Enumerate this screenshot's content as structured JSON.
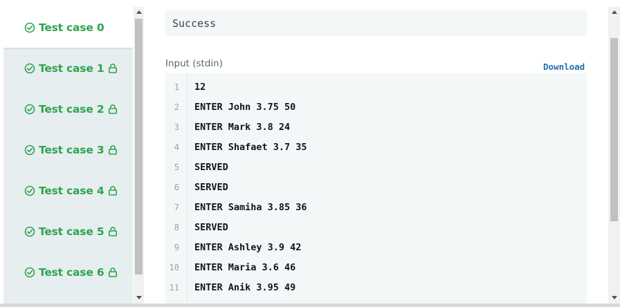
{
  "sidebar": {
    "items": [
      {
        "label": "Test case 0",
        "locked": false,
        "active": true
      },
      {
        "label": "Test case 1",
        "locked": true,
        "active": false
      },
      {
        "label": "Test case 2",
        "locked": true,
        "active": false
      },
      {
        "label": "Test case 3",
        "locked": true,
        "active": false
      },
      {
        "label": "Test case 4",
        "locked": true,
        "active": false
      },
      {
        "label": "Test case 5",
        "locked": true,
        "active": false
      },
      {
        "label": "Test case 6",
        "locked": true,
        "active": false
      }
    ]
  },
  "main": {
    "result": "Success",
    "input_label": "Input (stdin)",
    "download_label": "Download",
    "lines": [
      {
        "num": "1",
        "text": "12"
      },
      {
        "num": "2",
        "text": "ENTER John 3.75 50"
      },
      {
        "num": "3",
        "text": "ENTER Mark 3.8 24"
      },
      {
        "num": "4",
        "text": "ENTER Shafaet 3.7 35"
      },
      {
        "num": "5",
        "text": "SERVED"
      },
      {
        "num": "6",
        "text": "SERVED"
      },
      {
        "num": "7",
        "text": "ENTER Samiha 3.85 36"
      },
      {
        "num": "8",
        "text": "SERVED"
      },
      {
        "num": "9",
        "text": "ENTER Ashley 3.9 42"
      },
      {
        "num": "10",
        "text": "ENTER Maria 3.6 46"
      },
      {
        "num": "11",
        "text": "ENTER Anik 3.95 49"
      }
    ]
  },
  "colors": {
    "success_green": "#2ea44f",
    "link_blue": "#1f6fae",
    "sidebar_bg": "#e7eeef"
  },
  "icons": {
    "status": "check-circle-icon",
    "locked": "lock-icon"
  }
}
